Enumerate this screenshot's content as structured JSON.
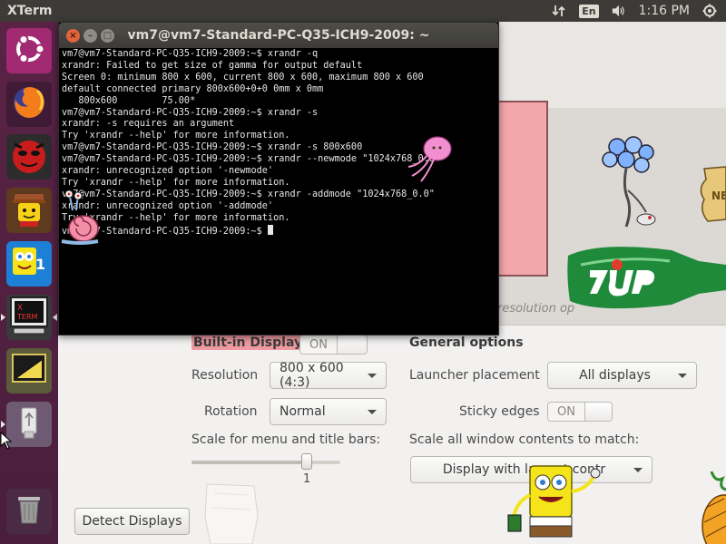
{
  "top_panel": {
    "app_title": "XTerm",
    "language": "En",
    "clock": "1:16 PM"
  },
  "launcher": {
    "items": [
      {
        "name": "ubuntu-dash",
        "icon": "ubuntu-logo-icon"
      },
      {
        "name": "firefox",
        "icon": "firefox-icon"
      },
      {
        "name": "app-red-face",
        "icon": "red-face-icon"
      },
      {
        "name": "app-lego",
        "icon": "lego-figure-icon"
      },
      {
        "name": "app-spongebob",
        "icon": "spongebob-icon"
      },
      {
        "name": "xterm",
        "icon": "xterm-icon",
        "label": "X\nTERM"
      },
      {
        "name": "app-ruler",
        "icon": "set-square-icon"
      },
      {
        "name": "usb-drive",
        "icon": "usb-icon"
      },
      {
        "name": "trash",
        "icon": "trash-icon"
      }
    ]
  },
  "terminal": {
    "title": "vm7@vm7-Standard-PC-Q35-ICH9-2009: ~",
    "lines": [
      "vm7@vm7-Standard-PC-Q35-ICH9-2009:~$ xrandr -q",
      "xrandr: Failed to get size of gamma for output default",
      "Screen 0: minimum 800 x 600, current 800 x 600, maximum 800 x 600",
      "default connected primary 800x600+0+0 0mm x 0mm",
      "   800x600        75.00*",
      "vm7@vm7-Standard-PC-Q35-ICH9-2009:~$ xrandr -s",
      "xrandr: -s requires an argument",
      "Try 'xrandr --help' for more information.",
      "vm7@vm7-Standard-PC-Q35-ICH9-2009:~$ xrandr -s 800x600",
      "vm7@vm7-Standard-PC-Q35-ICH9-2009:~$ xrandr --newmode \"1024x768_0.0\"",
      "xrandr: unrecognized option '-newmode'",
      "Try 'xrandr --help' for more information.",
      "vm7@vm7-Standard-PC-Q35-ICH9-2009:~$ xrandr -addmode \"1024x768_0.0\"",
      "xrandr: unrecognized option '-addmode'",
      "Try 'xrandr --help' for more information.",
      "vm7@vm7-Standard-PC-Q35-ICH9-2009:~$ "
    ]
  },
  "display_settings": {
    "resolution_caption": "resolution op",
    "builtin_display_label": "Built-in Display",
    "builtin_toggle": "ON",
    "resolution_label": "Resolution",
    "resolution_value": "800 x 600 (4:3)",
    "rotation_label": "Rotation",
    "rotation_value": "Normal",
    "scale_label": "Scale for menu and title bars:",
    "scale_value": "1",
    "scale_fraction": 0.77,
    "detect_button": "Detect Displays",
    "general_options_label": "General options",
    "launcher_placement_label": "Launcher placement",
    "launcher_placement_value": "All displays",
    "sticky_edges_label": "Sticky edges",
    "sticky_edges_toggle": "ON",
    "scale_all_label": "Scale all window contents to match:",
    "scale_all_value": "Display with largest contr"
  },
  "colors": {
    "panel": "#3c3b37",
    "launcher": "#5a2346",
    "terminal_bg": "#000000",
    "monitor_fill": "#f4a7ab",
    "builtin_highlight": "#ef9aa0"
  }
}
